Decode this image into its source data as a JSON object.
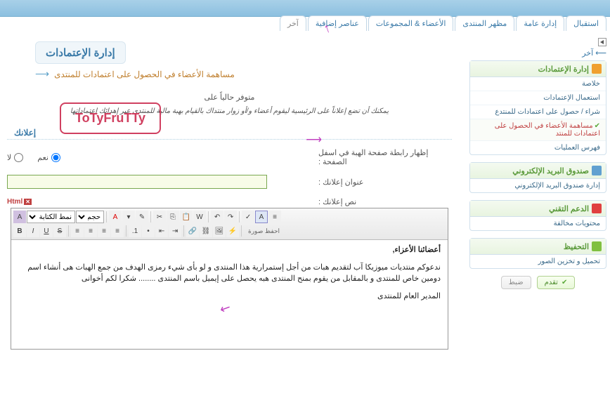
{
  "tabs": [
    "استقبال",
    "إدارة عامة",
    "مظهر المنتدى",
    "الأعضاء & المجموعات",
    "عناصر إضافية",
    "آخر"
  ],
  "breadcrumb": {
    "play": "▸",
    "text": "آخر",
    "arrow": "⟵"
  },
  "page_title": "إدارة الإعتمادات",
  "subtitle": "مساهمة الأعضاء في الحصول على اعتمادات للمنتدى",
  "badge": "ToTyFruTTy",
  "desc1": "متوفر حالياً على",
  "desc2": "يمكنك أن تضع إعلاناً على الرئيسية ليقوم أعضاء و/أو زوار منتداك بالقيام بهبة مالية للمنتدى عبر إهدائك اعتماداتها",
  "section_ad": "إعلانك",
  "form": {
    "show_footer_label": "إظهار رابطة صفحة الهبة في اسفل الصفحة :",
    "yes": "نعم",
    "no": "لا",
    "ad_title_label": "عنوان إعلانك :",
    "ad_title_value": "",
    "ad_text_label": "نص إعلانك :"
  },
  "html_badge": "Html",
  "editor": {
    "font_style": "نمط الكتابة",
    "line1": "أعضائنا الأعزاء,",
    "line2": "ندعوكم منتديات ميوزيكا آب لتقديم هبات من أجل إستمرارية هذا المنتدى و لو بأى شيء رمزى الهدف من جمع الهبات هى أنشاء اسم دومين خاص للمنتدى و بالمقابل من يقوم بمنح المنتدى هبه يحصل على إيميل باسم المنتدى ........ شكرا لكم أخوانى",
    "line3": "المدير العام للمنتدى",
    "footer": "احفظ صورة"
  },
  "sidebar": {
    "p1": {
      "title": "إدارة الإعتمادات",
      "items": [
        "خلاصة",
        "استعمال الإعتمادات",
        "شراء / حصول على اعتمادات للمنتدع",
        "مساهمة الأعضاء في الحصول على اعتمادات للمنتد",
        "فهرس العمليات"
      ]
    },
    "p2": {
      "title": "صندوق البريد الإلكتروني",
      "items": [
        "إدارة صندوق البريد الإلكتروني"
      ]
    },
    "p3": {
      "title": "الدعم التقني",
      "items": [
        "محتويات مخالفة"
      ]
    },
    "p4": {
      "title": "التحفيظ",
      "items": [
        "تحميل و تخزين الصور"
      ]
    }
  },
  "buttons": {
    "save": "تقدم",
    "reset": "ضبط"
  }
}
